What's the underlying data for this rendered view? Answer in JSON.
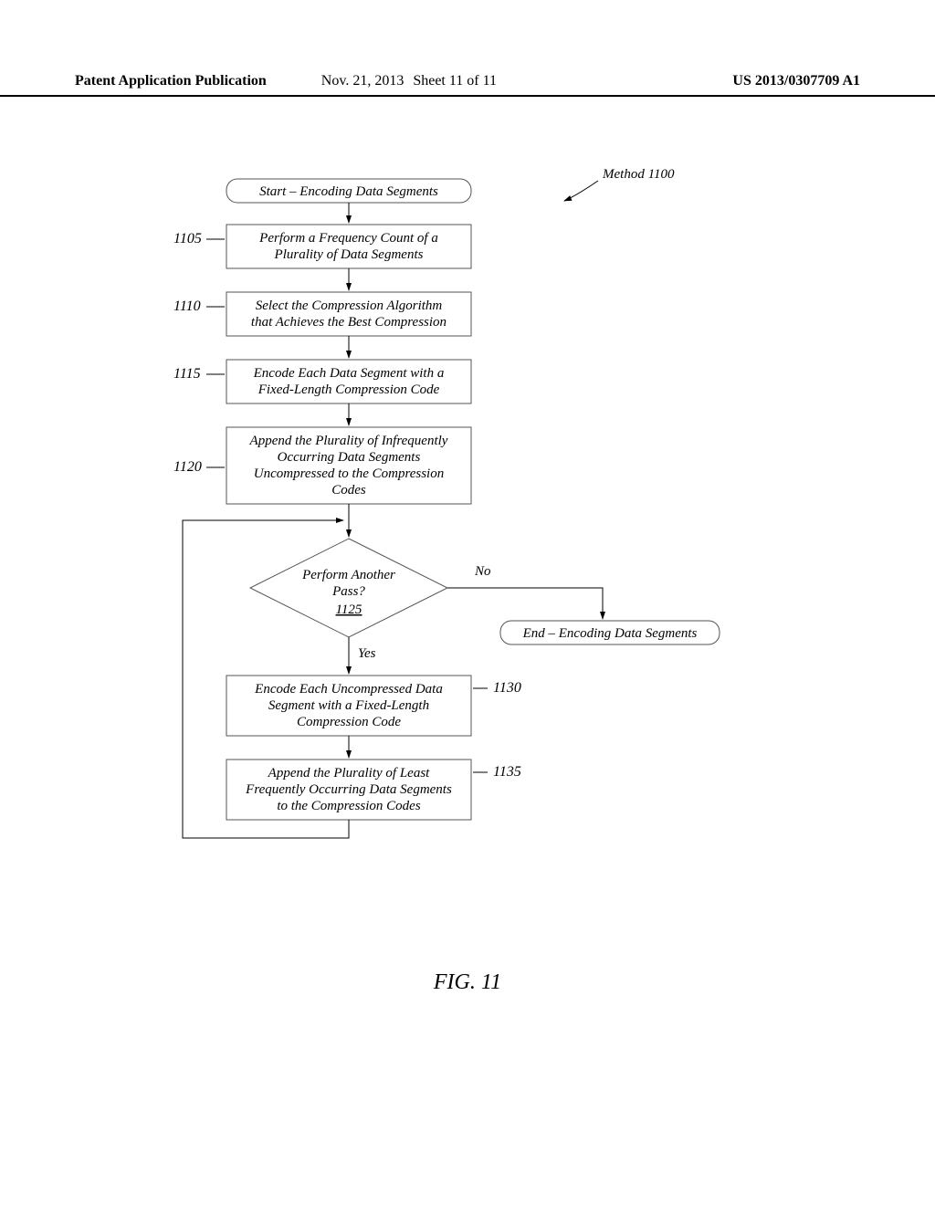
{
  "header": {
    "publication": "Patent Application Publication",
    "date": "Nov. 21, 2013",
    "sheet": "Sheet 11 of 11",
    "pubno": "US 2013/0307709 A1"
  },
  "method_label": "Method 1100",
  "figure_caption": "FIG. 11",
  "flowchart": {
    "start": "Start – Encoding Data Segments",
    "end": "End – Encoding Data Segments",
    "steps": {
      "s1105": {
        "ref": "1105",
        "text1": "Perform a Frequency Count of a",
        "text2": "Plurality of Data Segments"
      },
      "s1110": {
        "ref": "1110",
        "text1": "Select the Compression Algorithm",
        "text2": "that Achieves the Best Compression"
      },
      "s1115": {
        "ref": "1115",
        "text1": "Encode Each Data Segment with a",
        "text2": "Fixed-Length Compression Code"
      },
      "s1120": {
        "ref": "1120",
        "text1": "Append the Plurality of Infrequently",
        "text2": "Occurring Data Segments",
        "text3": "Uncompressed to the Compression",
        "text4": "Codes"
      },
      "s1125": {
        "ref": "1125",
        "text1": "Perform Another",
        "text2": "Pass?"
      },
      "s1130": {
        "ref": "1130",
        "text1": "Encode Each Uncompressed Data",
        "text2": "Segment with a Fixed-Length",
        "text3": "Compression Code"
      },
      "s1135": {
        "ref": "1135",
        "text1": "Append the Plurality of Least",
        "text2": "Frequently Occurring Data Segments",
        "text3": "to the Compression Codes"
      }
    },
    "branches": {
      "no": "No",
      "yes": "Yes"
    }
  }
}
